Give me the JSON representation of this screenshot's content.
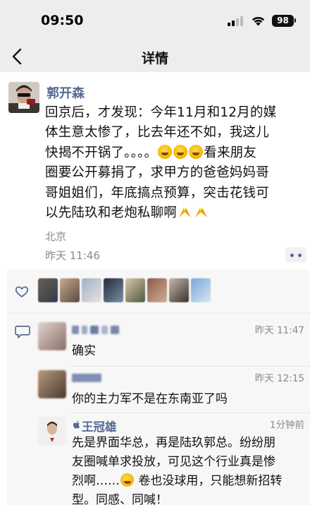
{
  "status_bar": {
    "time": "09:50",
    "battery": "98"
  },
  "nav": {
    "title": "详情"
  },
  "post": {
    "author": "郭开森",
    "text_lines": [
      "回京后，才发现：今年11月和12月的媒",
      "体生意太惨了，比去年还不如，我这儿",
      "快揭不开锅了。。。。",
      "看来朋友",
      "圈要公开募捐了，求甲方的爸爸妈妈哥",
      "哥姐姐们，年底搞点预算，突击花钱可",
      "以先陆玖和老炮私聊啊"
    ],
    "location": "北京",
    "time": "昨天 11:46"
  },
  "comments": [
    {
      "time": "昨天 11:47",
      "text": "确实"
    },
    {
      "time": "昨天 12:15",
      "text": "你的主力军不是在东南亚了吗"
    },
    {
      "author": "王冠雄",
      "time": "1分钟前",
      "lines": [
        "先是界面华总，再是陆玖郭总。纷纷朋",
        "友圈喊单求投放，可见这个行业真是惨",
        "烈啊……",
        "卷也没球用，只能想新招转",
        "型。同感、同喊！"
      ]
    }
  ],
  "icons": {
    "back": "chevron-left-icon",
    "like": "heart-outline-icon",
    "comment": "comment-bubble-icon",
    "more": "more-dots-icon",
    "verified": "apple-icon"
  },
  "colors": {
    "link": "#576b95",
    "background_gray": "#ededed",
    "panel": "#f7f7f7"
  }
}
